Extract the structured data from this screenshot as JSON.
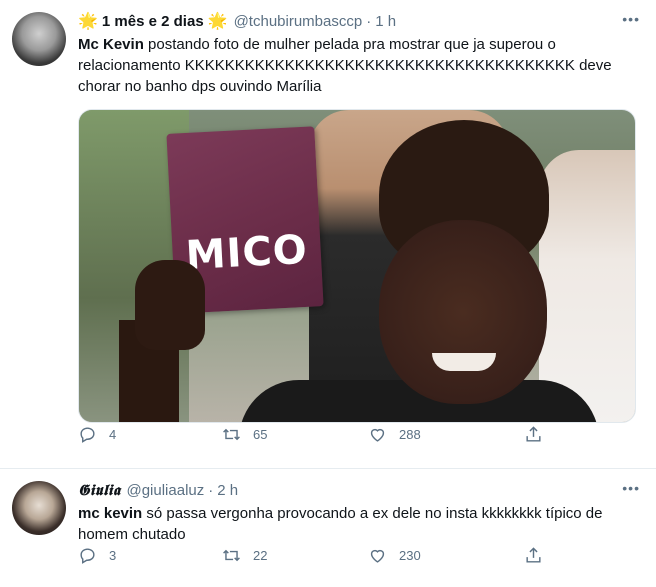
{
  "tweets": [
    {
      "display_name": "1 mês e 2 dias",
      "name_emoji": "🌟",
      "handle": "@tchubirumbasccp",
      "separator": "·",
      "time": "1 h",
      "more": "•••",
      "text_bold": "Mc Kevin",
      "text": " postando foto de mulher pelada pra mostrar que ja superou o relacionamento KKKKKKKKKKKKKKKKKKKKKKKKKKKKKKKKKKKKKKK deve chorar no banho dps ouvindo Marília",
      "media_sign_text": "MICO",
      "reply_count": "4",
      "retweet_count": "65",
      "like_count": "288"
    },
    {
      "display_name": "𝕲𝖎𝖚𝖑𝖎𝖆",
      "handle": "@giuliaaluz",
      "separator": "·",
      "time": "2 h",
      "more": "•••",
      "text_bold": "mc kevin",
      "text": " só passa vergonha provocando a ex dele no insta kkkkkkkk típico de homem chutado",
      "reply_count": "3",
      "retweet_count": "22",
      "like_count": "230"
    }
  ],
  "icons": [
    "reply-icon",
    "retweet-icon",
    "like-icon",
    "share-icon",
    "more-icon"
  ],
  "colors": {
    "secondary_text": "#5b7083",
    "divider": "#e6ecf0",
    "primary_text": "#0f1419"
  }
}
